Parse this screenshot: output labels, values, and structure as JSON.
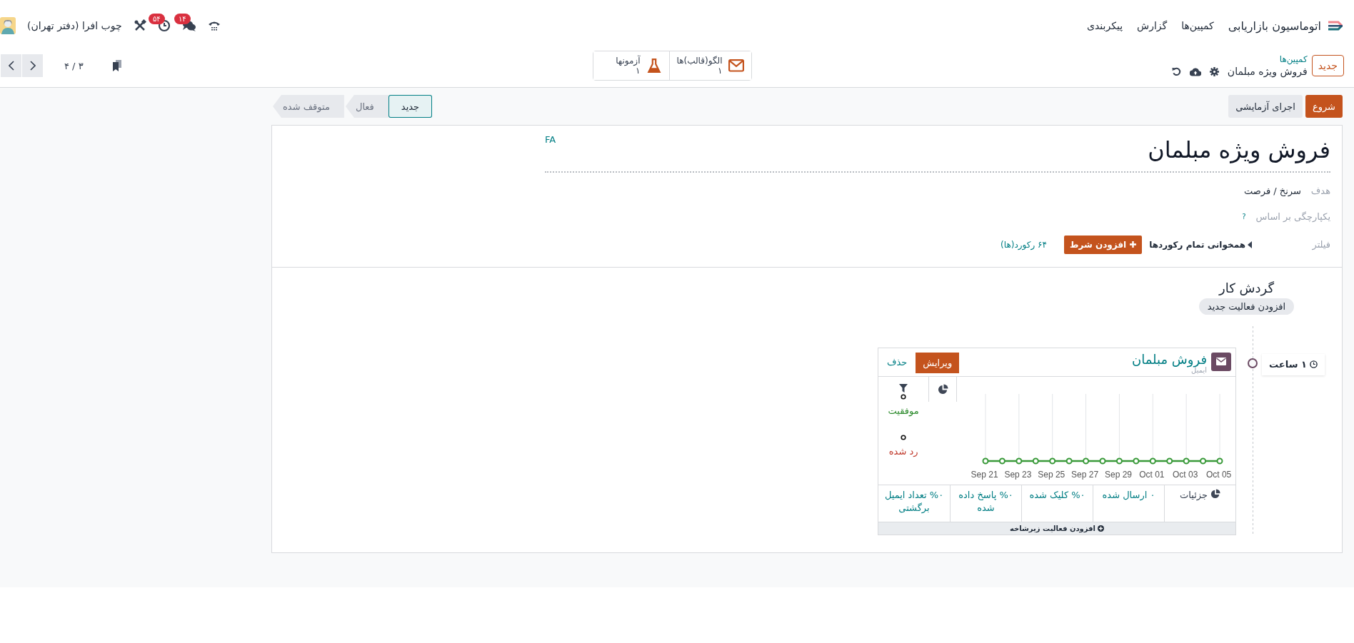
{
  "navbar": {
    "app_title": "اتوماسیون بازاریابی",
    "menu": [
      "کمپین‌ها",
      "گزارش",
      "پیکربندی"
    ],
    "chat_badge": "۱۴",
    "activity_badge": "۵۴",
    "company": "چوب افرا (دفتر تهران)"
  },
  "control_panel": {
    "new_button": "جدید",
    "breadcrumb": "کمپین‌ها",
    "record_title": "فروش ویژه مبلمان",
    "stat_buttons": [
      {
        "kind": "mail",
        "label": "الگو(قالب)ها",
        "value": "۱"
      },
      {
        "kind": "test",
        "label": "آزمونها",
        "value": "۱"
      }
    ],
    "pager": "۳ / ۴"
  },
  "status_bar": {
    "buttons": [
      {
        "kind": "primary",
        "label": "شروع"
      },
      {
        "kind": "secondary",
        "label": "اجرای آزمایشی"
      }
    ],
    "stages": [
      {
        "label": "جدید",
        "selected": true
      },
      {
        "label": "فعال",
        "selected": false
      },
      {
        "label": "متوقف شده",
        "selected": false
      }
    ]
  },
  "form": {
    "title": "فروش ویژه مبلمان",
    "language": "FA",
    "fields": [
      {
        "kind": "text",
        "label": "هدف",
        "value": "سرنخ / فرصت"
      },
      {
        "kind": "help",
        "label": "یکپارچگی بر اساس",
        "help": "?"
      },
      {
        "kind": "filter",
        "label": "فیلتر",
        "match": "همخوانی تمام رکوردها",
        "add_button": "افزودن شرط",
        "records": "۶۴ رکورد(ها)"
      }
    ]
  },
  "workflow": {
    "title": "گردش کار",
    "add_button": "افزودن فعالیت جدید",
    "activities": [
      {
        "trigger": "۱ ساعت",
        "title": "فروش مبلمان",
        "type": "ایمیل",
        "edit": "ویرایش",
        "delete": "حذف",
        "legend": [
          {
            "label": "موفقیت",
            "color": "#2e8b2e"
          },
          {
            "label": "رد شده",
            "color": "#c0392b"
          }
        ],
        "x_labels": [
          "Oct 05",
          "Oct 03",
          "Oct 01",
          "Sep 29",
          "Sep 27",
          "Sep 25",
          "Sep 23",
          "Sep 21"
        ],
        "stats": [
          {
            "kind": "details",
            "label": "جزئیات"
          },
          {
            "kind": "stat",
            "label": "۰ ارسال شده"
          },
          {
            "kind": "stat",
            "label": "%۰ کلیک شده"
          },
          {
            "kind": "stat",
            "label": "%۰ پاسخ داده شده"
          },
          {
            "kind": "stat",
            "label": "%۰ تعداد ایمیل برگشتی"
          }
        ],
        "add_child": "افزودن فعالیت زیرشاخه"
      }
    ]
  }
}
